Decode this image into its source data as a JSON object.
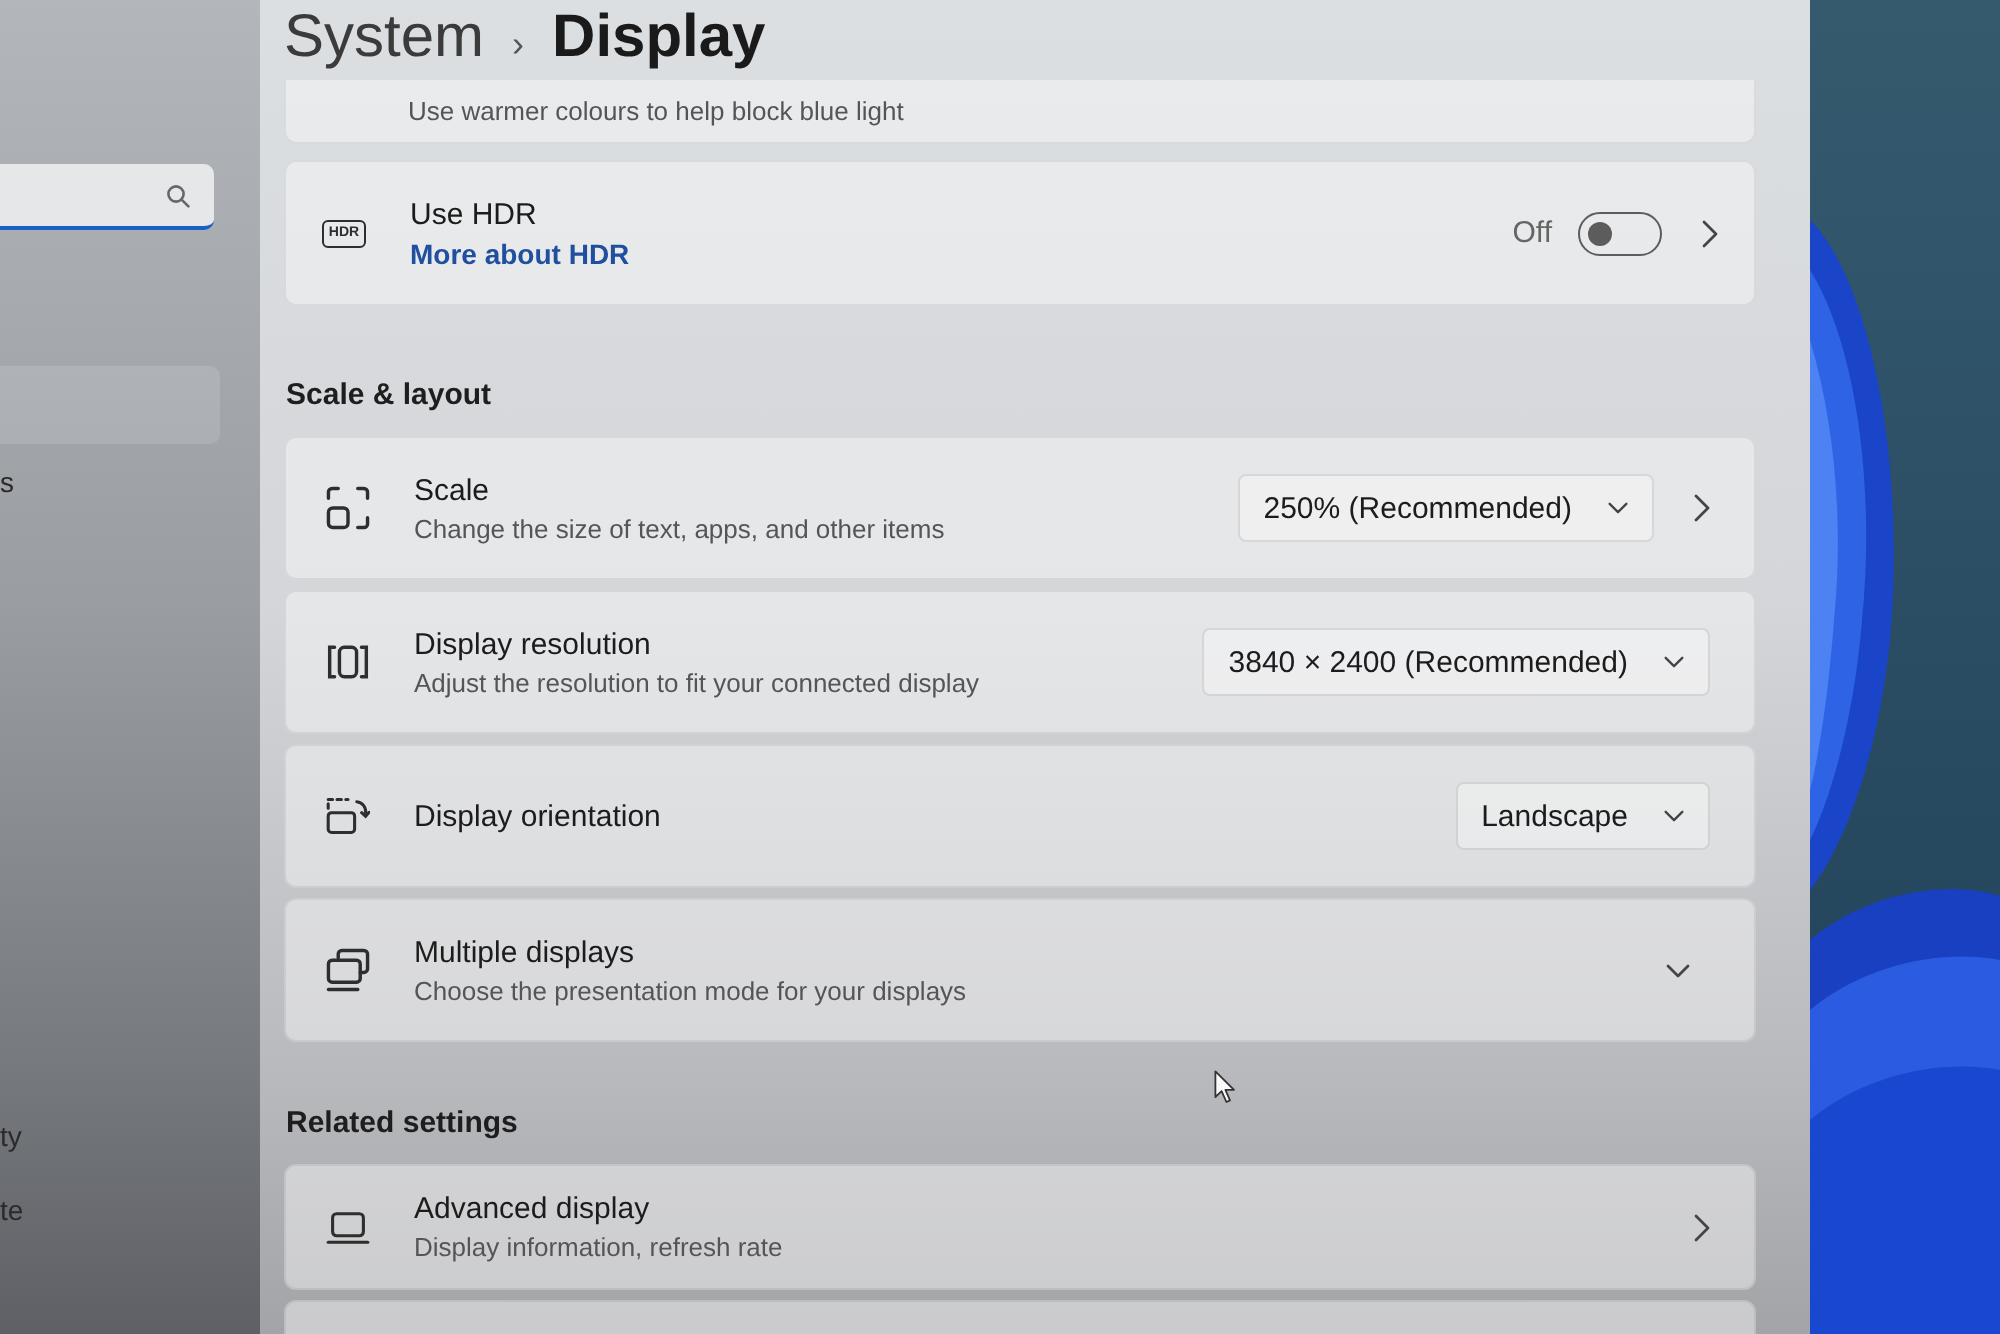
{
  "header": {
    "parent": "System",
    "separator": "›",
    "title": "Display"
  },
  "sidebar": {
    "items": [
      {
        "selected": true
      },
      {
        "label": "s",
        "selected": false
      },
      {
        "label": "ty",
        "selected": false
      },
      {
        "label": "te",
        "selected": false
      }
    ]
  },
  "night_light": {
    "description": "Use warmer colours to help block blue light"
  },
  "hdr": {
    "icon_text": "HDR",
    "title": "Use HDR",
    "link": "More about HDR",
    "state_label": "Off",
    "on": false
  },
  "sections": [
    {
      "heading": "Scale & layout",
      "rows": [
        {
          "kind": "dropdown",
          "title": "Scale",
          "description": "Change the size of text, apps, and other items",
          "value": "250% (Recommended)",
          "chevron": true
        },
        {
          "kind": "dropdown",
          "title": "Display resolution",
          "description": "Adjust the resolution to fit your connected display",
          "value": "3840 × 2400 (Recommended)",
          "chevron": false
        },
        {
          "kind": "dropdown",
          "title": "Display orientation",
          "value": "Landscape",
          "chevron": false
        },
        {
          "kind": "expander",
          "title": "Multiple displays",
          "description": "Choose the presentation mode for your displays"
        }
      ]
    },
    {
      "heading": "Related settings",
      "rows": [
        {
          "kind": "link",
          "title": "Advanced display",
          "description": "Display information, refresh rate"
        },
        {
          "kind": "cut_off"
        }
      ]
    }
  ]
}
